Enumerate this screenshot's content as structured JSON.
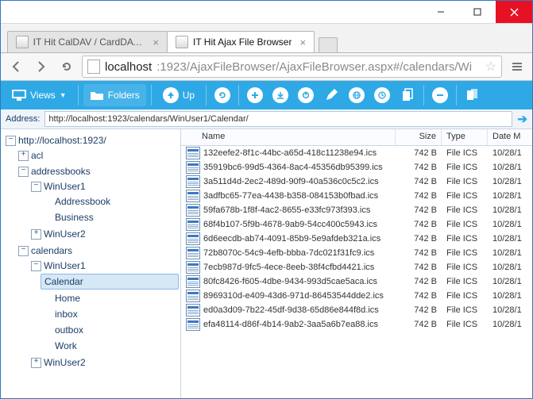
{
  "window": {
    "tabs": [
      {
        "label": "IT Hit CalDAV / CardDAV S",
        "active": false
      },
      {
        "label": "IT Hit Ajax File Browser",
        "active": true
      }
    ],
    "url_host": "localhost",
    "url_path": ":1923/AjaxFileBrowser/AjaxFileBrowser.aspx#/calendars/Wi"
  },
  "toolbar": {
    "views": "Views",
    "folders": "Folders",
    "up": "Up"
  },
  "address": {
    "label": "Address:",
    "value": "http://localhost:1923/calendars/WinUser1/Calendar/"
  },
  "tree": {
    "root": "http://localhost:1923/",
    "n_acl": "acl",
    "n_addressbooks": "addressbooks",
    "n_ab_winuser1": "WinUser1",
    "n_ab_addressbook": "Addressbook",
    "n_ab_business": "Business",
    "n_ab_winuser2": "WinUser2",
    "n_calendars": "calendars",
    "n_cal_winuser1": "WinUser1",
    "n_cal_calendar": "Calendar",
    "n_cal_home": "Home",
    "n_cal_inbox": "inbox",
    "n_cal_outbox": "outbox",
    "n_cal_work": "Work",
    "n_cal_winuser2": "WinUser2"
  },
  "columns": {
    "name": "Name",
    "size": "Size",
    "type": "Type",
    "date": "Date M"
  },
  "rows": [
    {
      "name": "132eefe2-8f1c-44bc-a65d-418c11238e94.ics",
      "size": "742 B",
      "type": "File ICS",
      "date": "10/28/1"
    },
    {
      "name": "35919bc6-99d5-4364-8ac4-45356db95399.ics",
      "size": "742 B",
      "type": "File ICS",
      "date": "10/28/1"
    },
    {
      "name": "3a511d4d-2ec2-489d-90f9-40a536c0c5c2.ics",
      "size": "742 B",
      "type": "File ICS",
      "date": "10/28/1"
    },
    {
      "name": "3adfbc65-77ea-4438-b358-084153b0fbad.ics",
      "size": "742 B",
      "type": "File ICS",
      "date": "10/28/1"
    },
    {
      "name": "59fa678b-1f8f-4ac2-8655-e33fc973f393.ics",
      "size": "742 B",
      "type": "File ICS",
      "date": "10/28/1"
    },
    {
      "name": "68f4b107-5f9b-4678-9ab9-54cc400c5943.ics",
      "size": "742 B",
      "type": "File ICS",
      "date": "10/28/1"
    },
    {
      "name": "6d6eecdb-ab74-4091-85b9-5e9afdeb321a.ics",
      "size": "742 B",
      "type": "File ICS",
      "date": "10/28/1"
    },
    {
      "name": "72b8070c-54c9-4efb-bbba-7dc021f31fc9.ics",
      "size": "742 B",
      "type": "File ICS",
      "date": "10/28/1"
    },
    {
      "name": "7ecb987d-9fc5-4ece-8eeb-38f4cfbd4421.ics",
      "size": "742 B",
      "type": "File ICS",
      "date": "10/28/1"
    },
    {
      "name": "80fc8426-f605-4dbe-9434-993d5cae5aca.ics",
      "size": "742 B",
      "type": "File ICS",
      "date": "10/28/1"
    },
    {
      "name": "8969310d-e409-43d6-971d-86453544dde2.ics",
      "size": "742 B",
      "type": "File ICS",
      "date": "10/28/1"
    },
    {
      "name": "ed0a3d09-7b22-45df-9d38-65d86e844f8d.ics",
      "size": "742 B",
      "type": "File ICS",
      "date": "10/28/1"
    },
    {
      "name": "efa48114-d86f-4b14-9ab2-3aa5a6b7ea88.ics",
      "size": "742 B",
      "type": "File ICS",
      "date": "10/28/1"
    }
  ]
}
